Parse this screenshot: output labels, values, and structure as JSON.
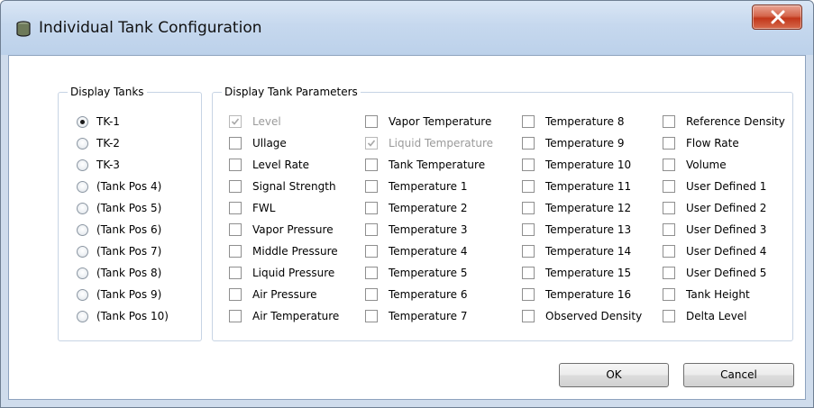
{
  "window": {
    "title": "Individual Tank Configuration"
  },
  "display_tanks": {
    "legend": "Display Tanks",
    "selected": "TK-1",
    "items": [
      "TK-1",
      "TK-2",
      "TK-3",
      "(Tank Pos 4)",
      "(Tank Pos 5)",
      "(Tank Pos 6)",
      "(Tank Pos 7)",
      "(Tank Pos 8)",
      "(Tank Pos 9)",
      "(Tank Pos 10)"
    ]
  },
  "parameters": {
    "legend": "Display Tank Parameters",
    "columns": [
      [
        {
          "label": "Level",
          "checked": true,
          "disabled": true
        },
        {
          "label": "Ullage",
          "checked": false,
          "disabled": false
        },
        {
          "label": "Level Rate",
          "checked": false,
          "disabled": false
        },
        {
          "label": "Signal Strength",
          "checked": false,
          "disabled": false
        },
        {
          "label": "FWL",
          "checked": false,
          "disabled": false
        },
        {
          "label": "Vapor Pressure",
          "checked": false,
          "disabled": false
        },
        {
          "label": "Middle Pressure",
          "checked": false,
          "disabled": false
        },
        {
          "label": "Liquid Pressure",
          "checked": false,
          "disabled": false
        },
        {
          "label": "Air Pressure",
          "checked": false,
          "disabled": false
        },
        {
          "label": "Air Temperature",
          "checked": false,
          "disabled": false
        }
      ],
      [
        {
          "label": "Vapor Temperature",
          "checked": false,
          "disabled": false
        },
        {
          "label": "Liquid Temperature",
          "checked": true,
          "disabled": true
        },
        {
          "label": "Tank Temperature",
          "checked": false,
          "disabled": false
        },
        {
          "label": "Temperature 1",
          "checked": false,
          "disabled": false
        },
        {
          "label": "Temperature 2",
          "checked": false,
          "disabled": false
        },
        {
          "label": "Temperature 3",
          "checked": false,
          "disabled": false
        },
        {
          "label": "Temperature 4",
          "checked": false,
          "disabled": false
        },
        {
          "label": "Temperature 5",
          "checked": false,
          "disabled": false
        },
        {
          "label": "Temperature 6",
          "checked": false,
          "disabled": false
        },
        {
          "label": "Temperature 7",
          "checked": false,
          "disabled": false
        }
      ],
      [
        {
          "label": "Temperature 8",
          "checked": false,
          "disabled": false
        },
        {
          "label": "Temperature 9",
          "checked": false,
          "disabled": false
        },
        {
          "label": "Temperature 10",
          "checked": false,
          "disabled": false
        },
        {
          "label": "Temperature 11",
          "checked": false,
          "disabled": false
        },
        {
          "label": "Temperature 12",
          "checked": false,
          "disabled": false
        },
        {
          "label": "Temperature 13",
          "checked": false,
          "disabled": false
        },
        {
          "label": "Temperature 14",
          "checked": false,
          "disabled": false
        },
        {
          "label": "Temperature 15",
          "checked": false,
          "disabled": false
        },
        {
          "label": "Temperature 16",
          "checked": false,
          "disabled": false
        },
        {
          "label": "Observed Density",
          "checked": false,
          "disabled": false
        }
      ],
      [
        {
          "label": "Reference Density",
          "checked": false,
          "disabled": false
        },
        {
          "label": "Flow Rate",
          "checked": false,
          "disabled": false
        },
        {
          "label": "Volume",
          "checked": false,
          "disabled": false
        },
        {
          "label": "User Defined 1",
          "checked": false,
          "disabled": false
        },
        {
          "label": "User Defined 2",
          "checked": false,
          "disabled": false
        },
        {
          "label": "User Defined 3",
          "checked": false,
          "disabled": false
        },
        {
          "label": "User Defined 4",
          "checked": false,
          "disabled": false
        },
        {
          "label": "User Defined 5",
          "checked": false,
          "disabled": false
        },
        {
          "label": "Tank Height",
          "checked": false,
          "disabled": false
        },
        {
          "label": "Delta Level",
          "checked": false,
          "disabled": false
        }
      ]
    ]
  },
  "buttons": {
    "ok": "OK",
    "cancel": "Cancel"
  },
  "icons": {
    "app": "tank-icon",
    "close": "close-icon"
  },
  "colors": {
    "title_bar": "#c6d8ee",
    "close_button": "#c8432a",
    "disabled_text": "#9a9a9a"
  }
}
